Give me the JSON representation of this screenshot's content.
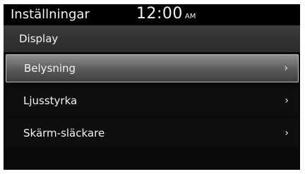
{
  "status_bar": {
    "title": "Inställningar",
    "time": "12:00",
    "ampm": "AM"
  },
  "section": {
    "title": "Display"
  },
  "menu": {
    "items": [
      {
        "label": "Belysning",
        "selected": true,
        "icon": "chevron-right-icon"
      },
      {
        "label": "Ljusstyrka",
        "selected": false,
        "icon": "chevron-right-icon"
      },
      {
        "label": "Skärm-släckare",
        "selected": false,
        "icon": "chevron-right-icon"
      }
    ],
    "chevron_glyph": "›"
  },
  "colors": {
    "background": "#0a0a0a",
    "text": "#f2f2f2",
    "selected_highlight": "#6e6e6e"
  }
}
